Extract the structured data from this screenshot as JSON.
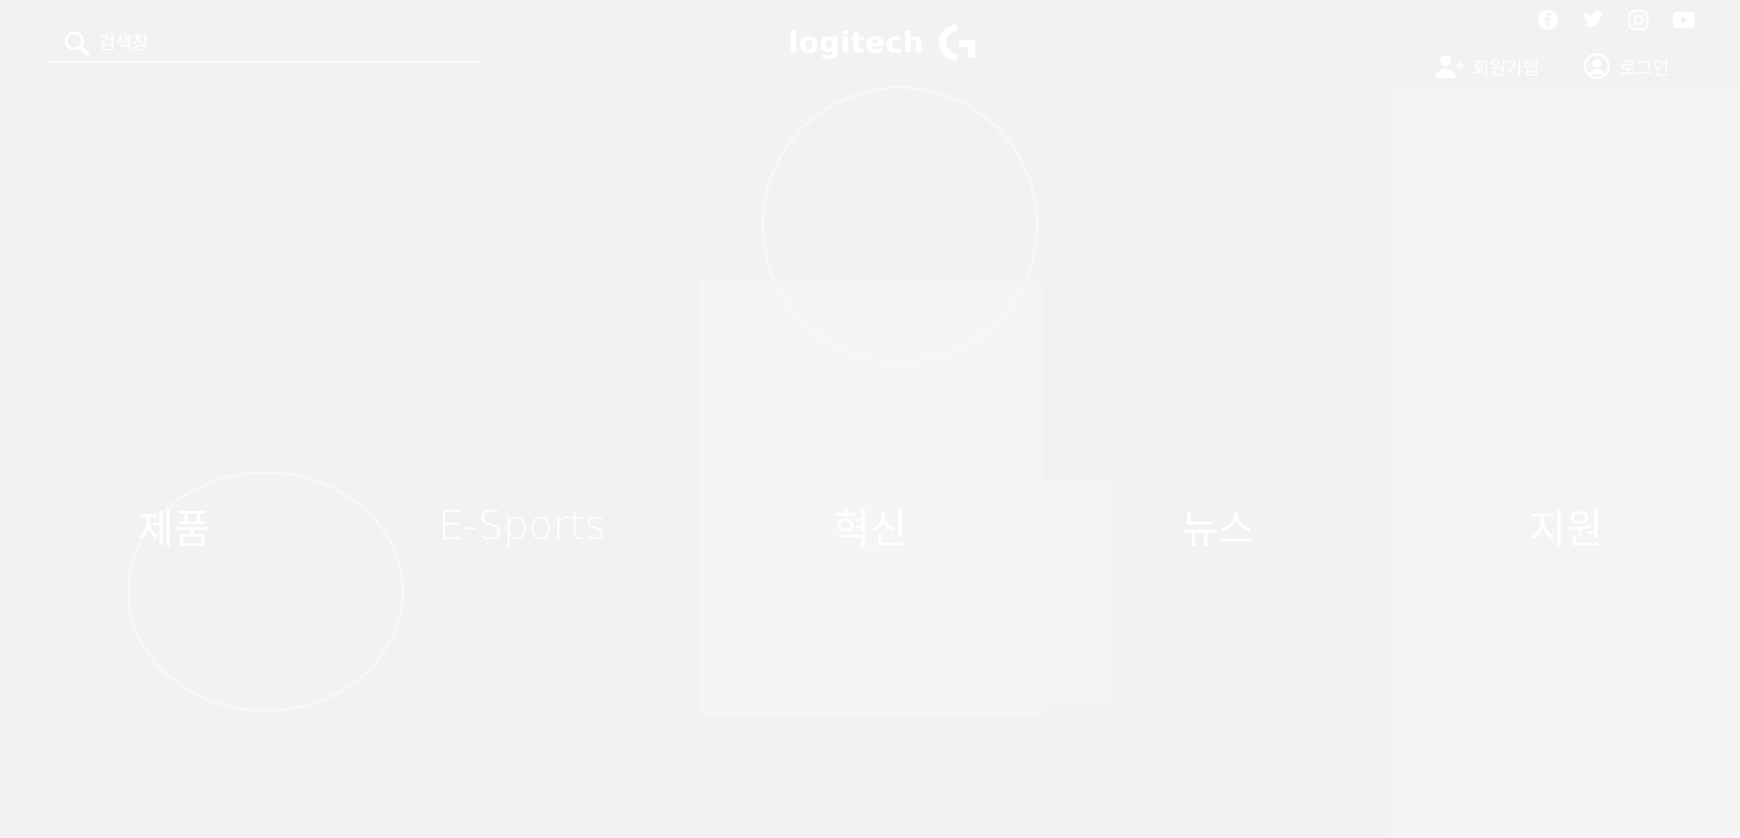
{
  "search": {
    "placeholder": "검색창"
  },
  "logo": {
    "text": "logitech"
  },
  "social": {
    "icons": [
      "facebook-icon",
      "twitter-icon",
      "instagram-icon",
      "youtube-icon"
    ]
  },
  "account": {
    "signup_label": "회원가입",
    "login_label": "로그인"
  },
  "nav": {
    "items": [
      "제품",
      "E-Sports",
      "혁신",
      "뉴스",
      "지원"
    ]
  },
  "colors": {
    "background": "#f2f2f2",
    "foreground": "#ffffff"
  }
}
